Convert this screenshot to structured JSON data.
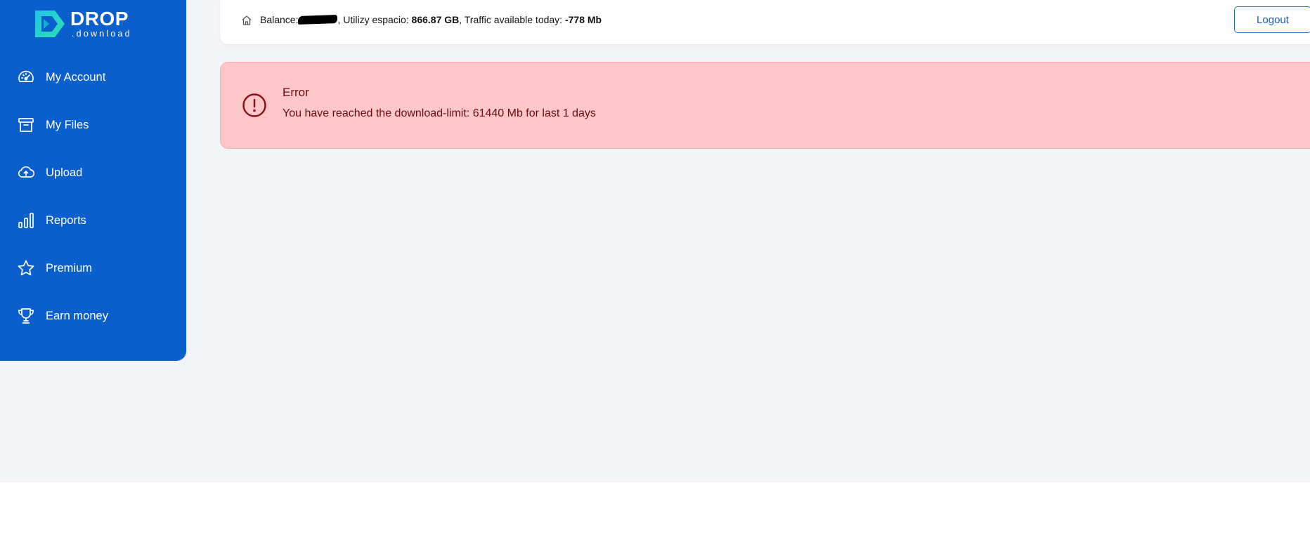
{
  "brand": {
    "name": "DROP",
    "sub": ".download"
  },
  "sidebar": {
    "items": [
      {
        "label": "My Account",
        "icon": "dashboard-gauge-icon"
      },
      {
        "label": "My Files",
        "icon": "archive-box-icon"
      },
      {
        "label": "Upload",
        "icon": "cloud-upload-icon"
      },
      {
        "label": "Reports",
        "icon": "bar-chart-icon"
      },
      {
        "label": "Premium",
        "icon": "star-icon"
      },
      {
        "label": "Earn money",
        "icon": "trophy-icon"
      }
    ]
  },
  "header": {
    "balance_label": "Balance:",
    "space_label": ", Utilizy espacio: ",
    "space_value": "866.87 GB",
    "traffic_label": ", Traffic available today: ",
    "traffic_value": "-778 Mb",
    "logout_label": "Logout"
  },
  "alert": {
    "title": "Error",
    "message": "You have reached the download-limit: 61440 Mb for last 1 days"
  },
  "colors": {
    "sidebar_bg": "#0b5fcc",
    "page_bg": "#f3f4f8",
    "alert_bg": "#ffc7c9",
    "alert_text": "#6b0a11",
    "accent": "#1d5fb8"
  }
}
